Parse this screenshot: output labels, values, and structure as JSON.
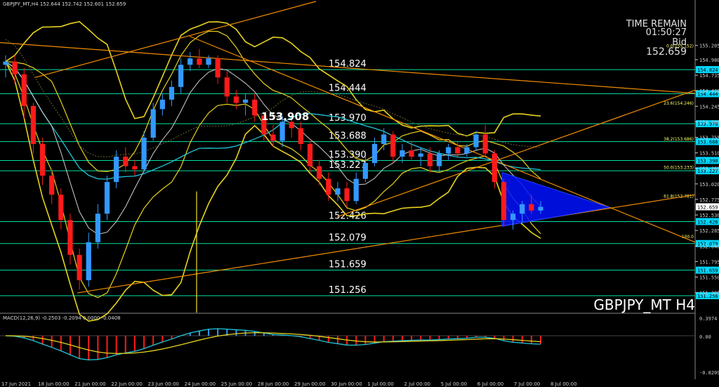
{
  "header": {
    "symbol_info": "GBPJPY_MT,H4  152.644 152.742 152.601 152.659",
    "macd_info": "MACD(12,26,9) -0.2503 -0.2094 0.0000 -0.0408"
  },
  "overlay": {
    "time_remain_label": "TIME REMAIN",
    "time_remain_value": "01:50:27",
    "bid_label": "Bid",
    "bid_value": "152.659",
    "watermark": "GBPJPY_MT H4",
    "highlight_price": "153.908"
  },
  "colors": {
    "background": "#000000",
    "bull": "#3399ff",
    "bear": "#ff1a1a",
    "bollinger": "#e6d21e",
    "ma": "#1fc6d8",
    "trendline": "#f08c00",
    "level_line": "#00ffff",
    "fib": "#ffff66",
    "triangle": "#0010ff"
  },
  "chart_data": {
    "type": "candlestick",
    "ylim": [
      150.99,
      155.9
    ],
    "y_ticks": [
      "155.940",
      "155.205",
      "154.980",
      "154.735",
      "154.490",
      "154.245",
      "154.000",
      "153.755",
      "153.510",
      "153.265",
      "153.020",
      "152.775",
      "152.530",
      "152.285",
      "152.040",
      "151.795",
      "151.550",
      "151.305"
    ],
    "x_ticks": [
      "17 Jun 2021",
      "18 Jun 00:00",
      "21 Jun 00:00",
      "22 Jun 00:00",
      "23 Jun 00:00",
      "24 Jun 00:00",
      "25 Jun 00:00",
      "28 Jun 00:00",
      "29 Jun 00:00",
      "30 Jun 00:00",
      "1 Jul 00:00",
      "2 Jul 00:00",
      "5 Jul 00:00",
      "6 Jul 00:00",
      "7 Jul 00:00",
      "8 Jul 00:00"
    ],
    "levels": [
      {
        "price": 154.824,
        "label": "154.824",
        "tag": "154.824"
      },
      {
        "price": 154.444,
        "label": "154.444",
        "tag": "154.444"
      },
      {
        "price": 153.97,
        "label": "153.970",
        "tag": "153.970"
      },
      {
        "price": 153.688,
        "label": "153.688",
        "tag": "153.688"
      },
      {
        "price": 153.39,
        "label": "153.390",
        "tag": "153.390"
      },
      {
        "price": 153.227,
        "label": "153.227",
        "tag": "153.227"
      },
      {
        "price": 152.426,
        "label": "152.426",
        "tag": "152.426"
      },
      {
        "price": 152.079,
        "label": "152.079",
        "tag": "152.079"
      },
      {
        "price": 151.659,
        "label": "151.659",
        "tag": "151.659"
      },
      {
        "price": 151.256,
        "label": "151.256",
        "tag": "151.256"
      }
    ],
    "fib_levels": [
      {
        "price": 155.152,
        "label": "0.0(155.152)"
      },
      {
        "price": 154.246,
        "label": "23.6(154.246)"
      },
      {
        "price": 153.686,
        "label": "38.2(153.686)"
      },
      {
        "price": 153.233,
        "label": "50.0(153.233)"
      },
      {
        "price": 152.781,
        "label": "61.8(152.781)"
      },
      {
        "price": 152.14,
        "label": "100.0"
      }
    ],
    "current_price": {
      "price": 152.659,
      "label": "152.659"
    },
    "candles": [
      [
        154.9,
        155.05,
        154.7,
        154.95
      ],
      [
        154.95,
        155.05,
        154.6,
        154.75
      ],
      [
        154.75,
        154.85,
        154.05,
        154.25
      ],
      [
        154.25,
        154.3,
        153.5,
        153.65
      ],
      [
        153.65,
        153.75,
        153.0,
        153.15
      ],
      [
        153.15,
        153.25,
        152.7,
        152.85
      ],
      [
        152.85,
        152.95,
        152.3,
        152.45
      ],
      [
        152.45,
        152.55,
        151.75,
        151.9
      ],
      [
        151.9,
        152.0,
        151.35,
        151.5
      ],
      [
        151.5,
        152.25,
        151.4,
        152.1
      ],
      [
        152.1,
        152.7,
        152.0,
        152.55
      ],
      [
        152.55,
        153.15,
        152.45,
        153.05
      ],
      [
        153.05,
        153.55,
        152.95,
        153.45
      ],
      [
        153.45,
        153.6,
        153.2,
        153.3
      ],
      [
        153.3,
        153.4,
        153.15,
        153.25
      ],
      [
        153.25,
        153.85,
        153.2,
        153.75
      ],
      [
        153.75,
        154.3,
        153.7,
        154.2
      ],
      [
        154.2,
        154.45,
        154.1,
        154.35
      ],
      [
        154.35,
        154.65,
        154.25,
        154.55
      ],
      [
        154.55,
        155.0,
        154.45,
        154.9
      ],
      [
        154.9,
        155.1,
        154.8,
        155.0
      ],
      [
        155.0,
        155.15,
        154.85,
        154.9
      ],
      [
        154.9,
        155.05,
        154.85,
        155.0
      ],
      [
        155.0,
        155.05,
        154.6,
        154.7
      ],
      [
        154.7,
        154.8,
        154.3,
        154.4
      ],
      [
        154.4,
        154.5,
        154.2,
        154.3
      ],
      [
        154.3,
        154.45,
        154.1,
        154.35
      ],
      [
        154.35,
        154.45,
        154.0,
        154.1
      ],
      [
        154.1,
        154.15,
        153.7,
        153.8
      ],
      [
        153.8,
        153.95,
        153.6,
        153.7
      ],
      [
        153.7,
        154.1,
        153.6,
        154.0
      ],
      [
        154.0,
        154.05,
        153.75,
        153.9
      ],
      [
        153.9,
        154.0,
        153.55,
        153.65
      ],
      [
        153.65,
        153.7,
        153.2,
        153.3
      ],
      [
        153.3,
        153.4,
        153.0,
        153.1
      ],
      [
        153.1,
        153.2,
        152.75,
        152.85
      ],
      [
        152.85,
        153.05,
        152.75,
        152.95
      ],
      [
        152.95,
        153.05,
        152.65,
        152.75
      ],
      [
        152.75,
        153.2,
        152.7,
        153.1
      ],
      [
        153.1,
        153.45,
        153.05,
        153.35
      ],
      [
        153.35,
        153.75,
        153.3,
        153.65
      ],
      [
        153.65,
        153.9,
        153.55,
        153.8
      ],
      [
        153.8,
        153.85,
        153.35,
        153.45
      ],
      [
        153.45,
        153.65,
        153.35,
        153.55
      ],
      [
        153.55,
        153.7,
        153.4,
        153.45
      ],
      [
        153.45,
        153.6,
        153.3,
        153.5
      ],
      [
        153.5,
        153.6,
        153.2,
        153.3
      ],
      [
        153.3,
        153.55,
        153.2,
        153.5
      ],
      [
        153.5,
        153.65,
        153.4,
        153.6
      ],
      [
        153.6,
        153.7,
        153.45,
        153.5
      ],
      [
        153.5,
        153.65,
        153.45,
        153.6
      ],
      [
        153.6,
        153.85,
        153.55,
        153.8
      ],
      [
        153.8,
        153.95,
        153.45,
        153.5
      ],
      [
        153.5,
        153.55,
        152.95,
        153.05
      ],
      [
        153.05,
        153.1,
        152.35,
        152.45
      ],
      [
        152.45,
        152.6,
        152.3,
        152.55
      ],
      [
        152.55,
        152.75,
        152.4,
        152.7
      ],
      [
        152.7,
        152.85,
        152.55,
        152.6
      ],
      [
        152.6,
        152.75,
        152.55,
        152.659
      ]
    ]
  }
}
